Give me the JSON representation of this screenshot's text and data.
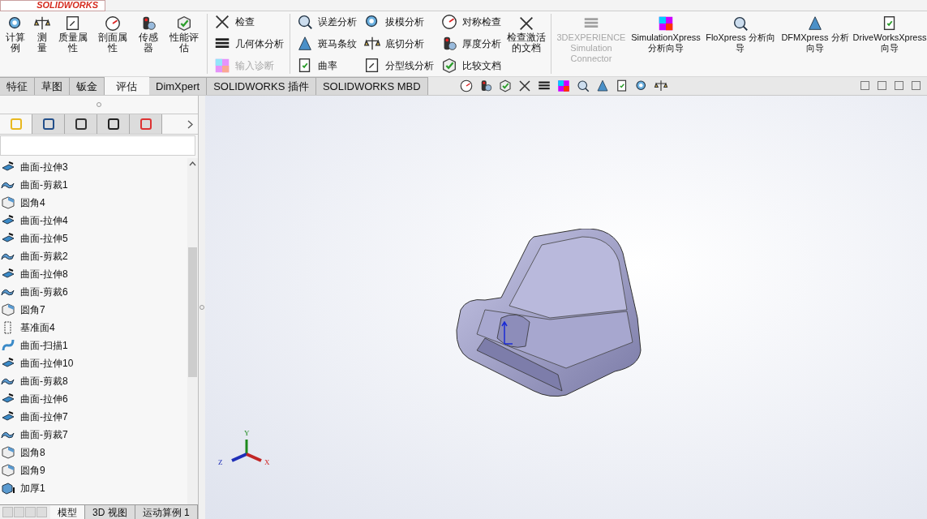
{
  "app": {
    "logo": "SOLIDWORKS"
  },
  "ribbon": {
    "columns": [
      {
        "kind": "big",
        "items": [
          {
            "label": "计算例",
            "disabled": false
          }
        ]
      },
      {
        "kind": "big",
        "items": [
          {
            "label": "测量",
            "disabled": false
          }
        ]
      },
      {
        "kind": "big",
        "items": [
          {
            "label": "质量属性",
            "disabled": false
          }
        ]
      },
      {
        "kind": "big",
        "items": [
          {
            "label": "剖面属性",
            "disabled": false
          }
        ]
      },
      {
        "kind": "big",
        "items": [
          {
            "label": "传感器",
            "disabled": false
          }
        ]
      },
      {
        "kind": "big",
        "items": [
          {
            "label": "性能评估",
            "disabled": false
          }
        ]
      },
      {
        "kind": "stack",
        "items": [
          {
            "label": "检查",
            "disabled": false
          },
          {
            "label": "几何体分析",
            "disabled": false
          },
          {
            "label": "输入诊断",
            "disabled": true
          }
        ]
      },
      {
        "kind": "stack",
        "items": [
          {
            "label": "误差分析",
            "disabled": false
          },
          {
            "label": "斑马条纹",
            "disabled": false
          },
          {
            "label": "曲率",
            "disabled": false
          }
        ]
      },
      {
        "kind": "stack",
        "items": [
          {
            "label": "拔模分析",
            "disabled": false
          },
          {
            "label": "底切分析",
            "disabled": false
          },
          {
            "label": "分型线分析",
            "disabled": false
          }
        ]
      },
      {
        "kind": "stack",
        "items": [
          {
            "label": "对称检查",
            "disabled": false
          },
          {
            "label": "厚度分析",
            "disabled": false
          },
          {
            "label": "比较文档",
            "disabled": false
          }
        ]
      },
      {
        "kind": "big",
        "items": [
          {
            "label": "检查激活的文档",
            "disabled": false
          }
        ]
      },
      {
        "kind": "big",
        "items": [
          {
            "label": "3DEXPERIENCE Simulation Connector",
            "disabled": true
          }
        ]
      },
      {
        "kind": "big",
        "items": [
          {
            "label": "SimulationXpress 分析向导",
            "disabled": false
          }
        ]
      },
      {
        "kind": "big",
        "items": [
          {
            "label": "FloXpress 分析向导",
            "disabled": false
          }
        ]
      },
      {
        "kind": "big",
        "items": [
          {
            "label": "DFMXpress 分析向导",
            "disabled": false
          }
        ]
      },
      {
        "kind": "big",
        "items": [
          {
            "label": "DriveWorksXpress 向导",
            "disabled": false
          }
        ]
      }
    ]
  },
  "tabs": [
    {
      "label": "特征",
      "selected": false
    },
    {
      "label": "草图",
      "selected": false
    },
    {
      "label": "钣金",
      "selected": false
    },
    {
      "label": "评估",
      "selected": true
    },
    {
      "label": "DimXpert",
      "selected": false
    },
    {
      "label": "SOLIDWORKS 插件",
      "selected": false
    },
    {
      "label": "SOLIDWORKS MBD",
      "selected": false
    }
  ],
  "tree": {
    "items": [
      {
        "kind": "extrude",
        "label": "曲面-拉伸3"
      },
      {
        "kind": "trim",
        "label": "曲面-剪裁1"
      },
      {
        "kind": "fillet",
        "label": "圆角4"
      },
      {
        "kind": "extrude",
        "label": "曲面-拉伸4"
      },
      {
        "kind": "extrude",
        "label": "曲面-拉伸5"
      },
      {
        "kind": "trim",
        "label": "曲面-剪裁2"
      },
      {
        "kind": "extrude",
        "label": "曲面-拉伸8"
      },
      {
        "kind": "trim",
        "label": "曲面-剪裁6"
      },
      {
        "kind": "fillet",
        "label": "圆角7"
      },
      {
        "kind": "plane",
        "label": "基准面4"
      },
      {
        "kind": "sweep",
        "label": "曲面-扫描1"
      },
      {
        "kind": "extrude",
        "label": "曲面-拉伸10"
      },
      {
        "kind": "trim",
        "label": "曲面-剪裁8"
      },
      {
        "kind": "extrude",
        "label": "曲面-拉伸6"
      },
      {
        "kind": "extrude",
        "label": "曲面-拉伸7"
      },
      {
        "kind": "trim",
        "label": "曲面-剪裁7"
      },
      {
        "kind": "fillet",
        "label": "圆角8"
      },
      {
        "kind": "fillet",
        "label": "圆角9"
      },
      {
        "kind": "thicken",
        "label": "加厚1"
      }
    ]
  },
  "panel_tabs": [
    {
      "selected": true
    },
    {
      "selected": false
    },
    {
      "selected": false
    },
    {
      "selected": false
    },
    {
      "selected": false
    }
  ],
  "bottom_tabs": [
    {
      "label": "模型",
      "selected": true
    },
    {
      "label": "3D 视图",
      "selected": false
    },
    {
      "label": "运动算例 1",
      "selected": false
    }
  ],
  "triad": {
    "y": "Y",
    "z": "Z",
    "x": "X"
  }
}
